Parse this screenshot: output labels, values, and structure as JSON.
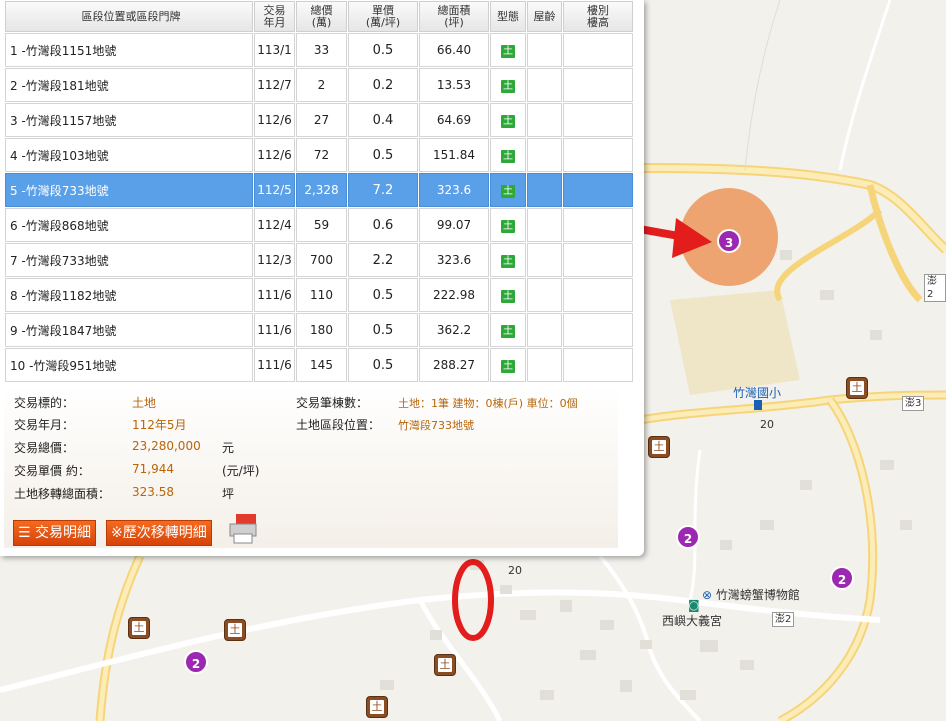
{
  "table": {
    "headers": {
      "location": "區段位置或區段門牌",
      "ym_1": "交易",
      "ym_2": "年月",
      "total_1": "總價",
      "total_2": "(萬)",
      "unit_1": "單價",
      "unit_2": "(萬/坪)",
      "area_1": "總面積",
      "area_2": "(坪)",
      "type": "型態",
      "age": "屋齡",
      "floor_1": "樓別",
      "floor_2": "樓高"
    },
    "type_glyph": "土",
    "rows": [
      {
        "location": "1 -竹灣段1151地號",
        "ym": "113/1",
        "total": "33",
        "unit": "0.5",
        "area": "66.40"
      },
      {
        "location": "2 -竹灣段181地號",
        "ym": "112/7",
        "total": "2",
        "unit": "0.2",
        "area": "13.53"
      },
      {
        "location": "3 -竹灣段1157地號",
        "ym": "112/6",
        "total": "27",
        "unit": "0.4",
        "area": "64.69"
      },
      {
        "location": "4 -竹灣段103地號",
        "ym": "112/6",
        "total": "72",
        "unit": "0.5",
        "area": "151.84"
      },
      {
        "location": "5 -竹灣段733地號",
        "ym": "112/5",
        "total": "2,328",
        "unit": "7.2",
        "area": "323.6"
      },
      {
        "location": "6 -竹灣段868地號",
        "ym": "112/4",
        "total": "59",
        "unit": "0.6",
        "area": "99.07"
      },
      {
        "location": "7 -竹灣段733地號",
        "ym": "112/3",
        "total": "700",
        "unit": "2.2",
        "area": "323.6"
      },
      {
        "location": "8 -竹灣段1182地號",
        "ym": "111/6",
        "total": "110",
        "unit": "0.5",
        "area": "222.98"
      },
      {
        "location": "9 -竹灣段1847地號",
        "ym": "111/6",
        "total": "180",
        "unit": "0.5",
        "area": "362.2"
      },
      {
        "location": "10 -竹灣段951地號",
        "ym": "111/6",
        "total": "145",
        "unit": "0.5",
        "area": "288.27"
      }
    ]
  },
  "detail": {
    "target_label": "交易標的：",
    "target_value": "土地",
    "ym_label": "交易年月：",
    "ym_value": "112年5月",
    "total_label": "交易總價：",
    "total_value": "23,280,000",
    "total_unit": "元",
    "unit_label": "交易單價 約：",
    "unit_value": "71,944",
    "unit_unit": "(元/坪)",
    "area_label": "土地移轉總面積：",
    "area_value": "323.58",
    "area_unit": "坪",
    "count_label": "交易筆棟數：",
    "count_value": "土地：1筆 建物：0棟(戶) 車位：0個",
    "loc_label": "土地區段位置：",
    "loc_value": "竹灣段733地號"
  },
  "buttons": {
    "detail_label": "交易明細",
    "history_label": "※歷次移轉明細"
  },
  "map": {
    "labels": {
      "school": "竹灣國小",
      "museum": "竹灣螃蟹博物館",
      "temple": "西嶼大義宮"
    },
    "road_tags": [
      "澎2",
      "澎3",
      "澎2"
    ],
    "road_numbers": [
      "20",
      "20"
    ],
    "clusters": [
      "3",
      "2",
      "2",
      "2"
    ],
    "land_glyph": "土"
  },
  "colors": {
    "selected_row": "#5aa0e8",
    "value_text": "#b8650a",
    "button": "#e4561a",
    "cluster": "#9c27b0",
    "highlight_circle": "#ec965a",
    "arrow": "#e31c1c"
  }
}
